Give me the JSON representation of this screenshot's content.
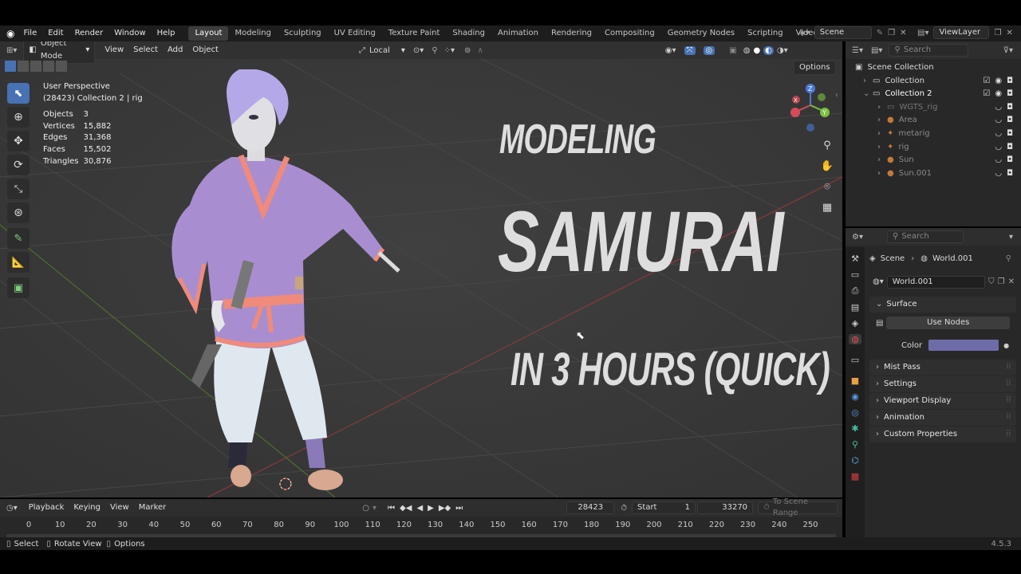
{
  "topbar": {
    "menus": [
      "File",
      "Edit",
      "Render",
      "Window",
      "Help"
    ],
    "workspaces": [
      "Layout",
      "Modeling",
      "Sculpting",
      "UV Editing",
      "Texture Paint",
      "Shading",
      "Animation",
      "Rendering",
      "Compositing",
      "Geometry Nodes",
      "Scripting",
      "Video Editing"
    ],
    "active_workspace": "Layout",
    "scene": "Scene",
    "view_layer": "ViewLayer"
  },
  "viewport": {
    "mode": "Object Mode",
    "menus": [
      "View",
      "Select",
      "Add",
      "Object"
    ],
    "transform_space": "Local",
    "options": "Options",
    "info_line1": "User Perspective",
    "info_line2": "(28423) Collection 2 | rig",
    "stats": [
      {
        "label": "Objects",
        "value": "3"
      },
      {
        "label": "Vertices",
        "value": "15,882"
      },
      {
        "label": "Edges",
        "value": "31,368"
      },
      {
        "label": "Faces",
        "value": "15,502"
      },
      {
        "label": "Triangles",
        "value": "30,876"
      }
    ],
    "overlay": {
      "line1": "MODELING",
      "line2": "SAMURAI",
      "line3": "IN 3 HOURS (QUICK)"
    },
    "axes": {
      "x": "X",
      "y": "Y",
      "z": "Z"
    }
  },
  "outliner": {
    "search_placeholder": "Search",
    "root": "Scene Collection",
    "items": [
      {
        "label": "Collection",
        "indent": 1
      },
      {
        "label": "Collection 2",
        "indent": 1
      },
      {
        "label": "WGTS_rig",
        "indent": 2
      },
      {
        "label": "Area",
        "indent": 2
      },
      {
        "label": "metarig",
        "indent": 2
      },
      {
        "label": "rig",
        "indent": 2
      },
      {
        "label": "Sun",
        "indent": 2
      },
      {
        "label": "Sun.001",
        "indent": 2
      }
    ]
  },
  "properties": {
    "search_placeholder": "Search",
    "breadcrumb_scene": "Scene",
    "breadcrumb_world": "World.001",
    "world_name": "World.001",
    "surface": "Surface",
    "use_nodes": "Use Nodes",
    "color_label": "Color",
    "color_value": "#6e6ca8",
    "panels": [
      "Mist Pass",
      "Settings",
      "Viewport Display",
      "Animation",
      "Custom Properties"
    ]
  },
  "timeline": {
    "menus": [
      "Playback",
      "Keying",
      "View",
      "Marker"
    ],
    "current_frame": "28423",
    "start_label": "Start",
    "start": "1",
    "end": "33270",
    "scene_range": "To Scene Range",
    "ticks": [
      "0",
      "10",
      "20",
      "30",
      "40",
      "50",
      "60",
      "70",
      "80",
      "90",
      "100",
      "110",
      "120",
      "130",
      "140",
      "150",
      "160",
      "170",
      "180",
      "190",
      "200",
      "210",
      "220",
      "230",
      "240",
      "250"
    ]
  },
  "statusbar": {
    "select": "Select",
    "rotate": "Rotate View",
    "options": "Options",
    "version": "4.5.3"
  }
}
